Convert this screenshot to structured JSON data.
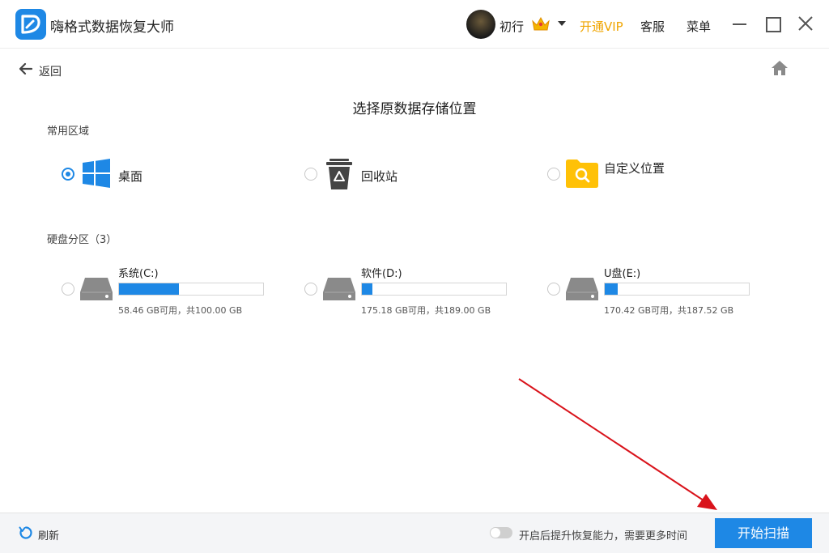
{
  "app": {
    "title": "嗨格式数据恢复大师"
  },
  "user": {
    "name": "初行"
  },
  "header": {
    "vip_label": "开通VIP",
    "service_label": "客服",
    "menu_label": "菜单"
  },
  "nav": {
    "back_label": "返回"
  },
  "main": {
    "title": "选择原数据存储位置",
    "common_section_label": "常用区域",
    "locations": [
      {
        "label": "桌面",
        "icon": "windows-icon",
        "selected": true
      },
      {
        "label": "回收站",
        "icon": "recycle-bin-icon",
        "selected": false
      },
      {
        "label": "自定义位置",
        "icon": "folder-search-icon",
        "selected": false
      }
    ],
    "disk_section_label": "硬盘分区（3）",
    "drives": [
      {
        "name": "系统(C:)",
        "caption": "58.46 GB可用，共100.00 GB",
        "used_fraction": 0.4154,
        "selected": false
      },
      {
        "name": "软件(D:)",
        "caption": "175.18 GB可用，共189.00 GB",
        "used_fraction": 0.0731,
        "selected": false
      },
      {
        "name": "U盘(E:)",
        "caption": "170.42 GB可用，共187.52 GB",
        "used_fraction": 0.0912,
        "selected": false
      }
    ]
  },
  "footer": {
    "refresh_label": "刷新",
    "toggle_label": "开启后提升恢复能力，需要更多时间",
    "toggle_on": false,
    "scan_button_label": "开始扫描"
  },
  "colors": {
    "accent": "#1e88e5",
    "vip": "#f0a500",
    "folder": "#ffc107",
    "annotation_arrow": "#d9131b"
  }
}
